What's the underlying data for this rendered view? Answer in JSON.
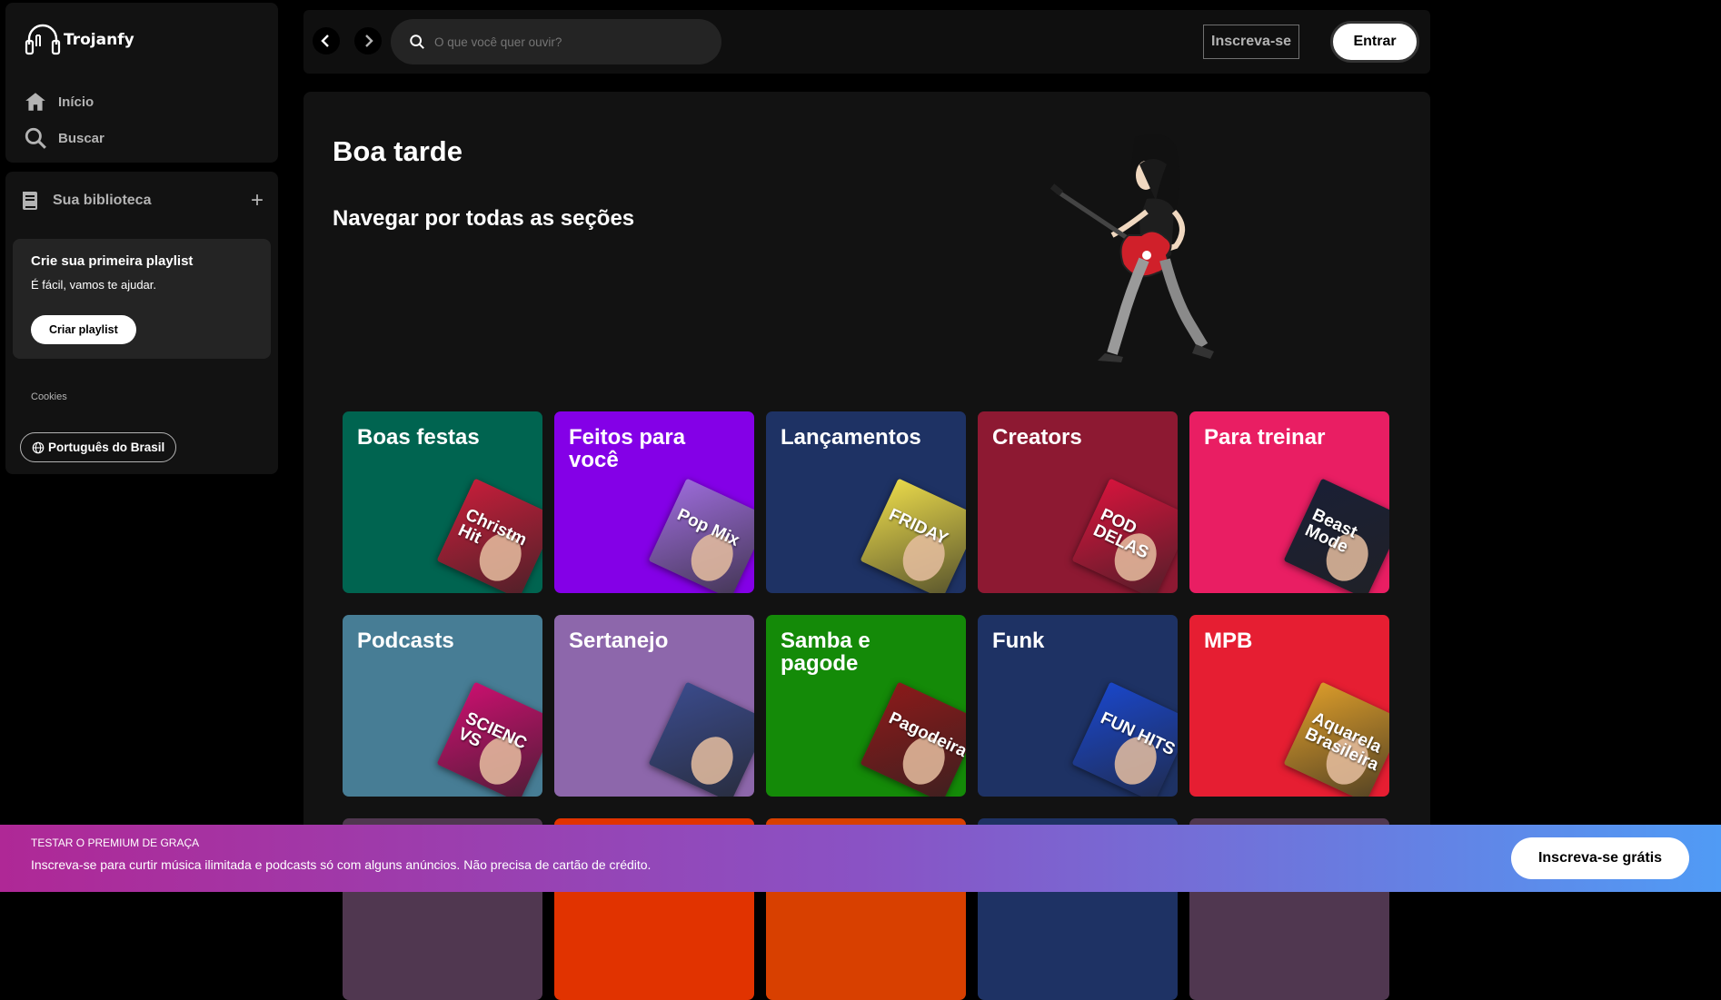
{
  "app": {
    "name": "Trojanfy"
  },
  "nav": {
    "home": "Início",
    "search": "Buscar"
  },
  "library": {
    "title": "Sua biblioteca",
    "card_title": "Crie sua primeira playlist",
    "card_sub": "É fácil, vamos te ajudar.",
    "card_button": "Criar playlist",
    "cookies": "Cookies",
    "language": "Português do Brasil"
  },
  "topbar": {
    "search_placeholder": "O que você quer ouvir?",
    "signup": "Inscreva-se",
    "login": "Entrar"
  },
  "main": {
    "greeting": "Boa tarde",
    "browse": "Navegar por todas as seções",
    "tiles": [
      {
        "label": "Boas festas",
        "color": "#006450",
        "art_color": "#c41e3a",
        "art_text": "Christm Hit"
      },
      {
        "label": "Feitos para você",
        "color": "#8400e7",
        "art_color": "#9b6bd8",
        "art_text": "Pop Mix"
      },
      {
        "label": "Lançamentos",
        "color": "#1e3264",
        "art_color": "#e8d84a",
        "art_text": "FRIDAY"
      },
      {
        "label": "Creators",
        "color": "#8d1932",
        "art_color": "#d4143c",
        "art_text": "POD DELAS"
      },
      {
        "label": "Para treinar",
        "color": "#e91e63",
        "art_color": "#1a1f35",
        "art_text": "Beast Mode"
      },
      {
        "label": "Podcasts",
        "color": "#477d95",
        "art_color": "#c8106e",
        "art_text": "SCIENC VS"
      },
      {
        "label": "Sertanejo",
        "color": "#8d67ab",
        "art_color": "#3a4a8a",
        "art_text": ""
      },
      {
        "label": "Samba e pagode",
        "color": "#148a08",
        "art_color": "#8a1a1a",
        "art_text": "Pagodeira"
      },
      {
        "label": "Funk",
        "color": "#1e3264",
        "art_color": "#1a46c8",
        "art_text": "FUN HITS"
      },
      {
        "label": "MPB",
        "color": "#e61e32",
        "art_color": "#d89a2a",
        "art_text": "Aquarela Brasileira"
      }
    ],
    "partial_colors": [
      "#503750",
      "#e13300",
      "#d84000",
      "#1e3264",
      "#503750"
    ]
  },
  "banner": {
    "kicker": "TESTAR O PREMIUM DE GRAÇA",
    "text": "Inscreva-se para curtir música ilimitada e podcasts só com alguns anúncios. Não precisa de cartão de crédito.",
    "button": "Inscreva-se grátis"
  }
}
